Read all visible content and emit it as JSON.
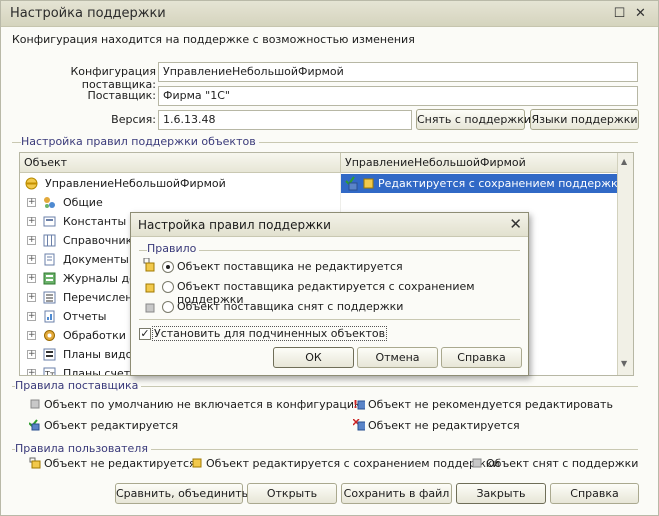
{
  "window": {
    "title": "Настройка поддержки",
    "subtitle": "Конфигурация находится на поддержке с возможностью изменения"
  },
  "form": {
    "vendor_config_label": "Конфигурация поставщика:",
    "vendor_config_value": "УправлениеНебольшойФирмой",
    "vendor_label": "Поставщик:",
    "vendor_value": "Фирма \"1С\"",
    "version_label": "Версия:",
    "version_value": "1.6.13.48",
    "remove_support_button": "Снять с поддержки",
    "support_languages_button": "Языки поддержки"
  },
  "rules_group": {
    "title": "Настройка правил поддержки объектов",
    "columns": [
      "Объект",
      "УправлениеНебольшойФирмой"
    ],
    "root": {
      "name": "УправлениеНебольшойФирмой",
      "rule": "Редактируется с сохранением поддержки"
    },
    "items": [
      {
        "name": "Общие",
        "icon": "general-icon"
      },
      {
        "name": "Константы",
        "icon": "constants-icon"
      },
      {
        "name": "Справочники",
        "icon": "catalogs-icon"
      },
      {
        "name": "Документы",
        "icon": "documents-icon"
      },
      {
        "name": "Журналы до",
        "icon": "journals-icon"
      },
      {
        "name": "Перечислен",
        "icon": "enums-icon"
      },
      {
        "name": "Отчеты",
        "icon": "reports-icon"
      },
      {
        "name": "Обработки",
        "icon": "dataprocessors-icon"
      },
      {
        "name": "Планы видов",
        "icon": "charts-icon"
      },
      {
        "name": "Планы счето",
        "icon": "accounts-icon"
      }
    ]
  },
  "dialog": {
    "title": "Настройка правил поддержки",
    "group_title": "Правило",
    "options": [
      {
        "label": "Объект поставщика не редактируется",
        "selected": true
      },
      {
        "label": "Объект поставщика редактируется с сохранением поддержки",
        "selected": false
      },
      {
        "label": "Объект поставщика снят с поддержки",
        "selected": false
      }
    ],
    "apply_to_children_label": "Установить для подчиненных объектов",
    "apply_to_children_checked": true,
    "ok_button": "ОК",
    "cancel_button": "Отмена",
    "help_button": "Справка"
  },
  "vendor_rules": {
    "title": "Правила поставщика",
    "items": [
      "Объект по умолчанию не включается в конфигурацию",
      "Объект не рекомендуется редактировать",
      "Объект редактируется",
      "Объект не редактируется"
    ]
  },
  "user_rules": {
    "title": "Правила пользователя",
    "items": [
      "Объект не редактируется",
      "Объект редактируется с сохранением поддержки",
      "Объект снят с поддержки"
    ]
  },
  "footer": {
    "compare_button": "Сравнить, объединить",
    "open_button": "Открыть",
    "save_file_button": "Сохранить в файл",
    "close_button": "Закрыть",
    "help_button": "Справка"
  },
  "colors": {
    "selection": "#3169c6",
    "group_title": "#3a3a7a"
  }
}
